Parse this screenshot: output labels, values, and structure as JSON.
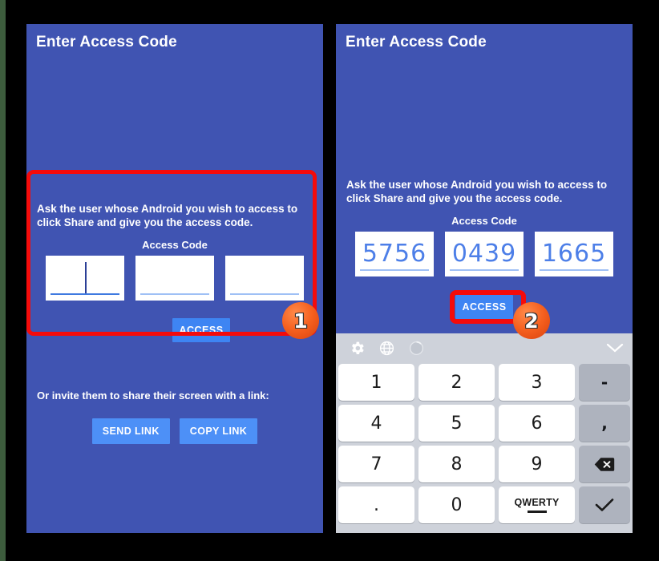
{
  "meta": {
    "background_color": "#000000",
    "panel_color": "#4054b2",
    "highlight_color": "#f40b0b",
    "badge_color": "#f5601f",
    "accent_button_color": "#3e85f3",
    "code_text_color": "#4d7fe8",
    "keyboard_background": "#ced2da"
  },
  "panel_left": {
    "app_title": "Enter Access Code",
    "instructions": "Ask the user whose Android you wish to access to click Share and give you the access code.",
    "code_label": "Access Code",
    "code_fields": [
      {
        "value": "",
        "focused": true
      },
      {
        "value": "",
        "focused": false
      },
      {
        "value": "",
        "focused": false
      }
    ],
    "access_button": "ACCESS",
    "invite_text": "Or invite them to share their screen with a link:",
    "send_link_button": "SEND LINK",
    "copy_link_button": "COPY LINK"
  },
  "panel_right": {
    "app_title": "Enter Access Code",
    "instructions": "Ask the user whose Android you wish to access to click Share and give you the access code.",
    "code_label": "Access Code",
    "code_fields": [
      {
        "value": "5756",
        "focused": false
      },
      {
        "value": "0439",
        "focused": false
      },
      {
        "value": "1665",
        "focused": false
      }
    ],
    "access_button": "ACCESS"
  },
  "annotations": {
    "badge_1": "1",
    "badge_2": "2"
  },
  "keyboard": {
    "toolbar_icons": [
      "gear-icon",
      "globe-icon",
      "voice-icon",
      "chevron-down-icon"
    ],
    "rows": [
      [
        {
          "label": "1",
          "type": "digit"
        },
        {
          "label": "2",
          "type": "digit"
        },
        {
          "label": "3",
          "type": "digit"
        },
        {
          "label": "-",
          "type": "function"
        }
      ],
      [
        {
          "label": "4",
          "type": "digit"
        },
        {
          "label": "5",
          "type": "digit"
        },
        {
          "label": "6",
          "type": "digit"
        },
        {
          "label": ",",
          "type": "function"
        }
      ],
      [
        {
          "label": "7",
          "type": "digit"
        },
        {
          "label": "8",
          "type": "digit"
        },
        {
          "label": "9",
          "type": "digit"
        },
        {
          "label": "backspace-icon",
          "type": "function-icon"
        }
      ],
      [
        {
          "label": ".",
          "type": "digit"
        },
        {
          "label": "0",
          "type": "digit"
        },
        {
          "label": "QWERTY",
          "type": "switch"
        },
        {
          "label": "checkmark-icon",
          "type": "function-icon"
        }
      ]
    ]
  }
}
